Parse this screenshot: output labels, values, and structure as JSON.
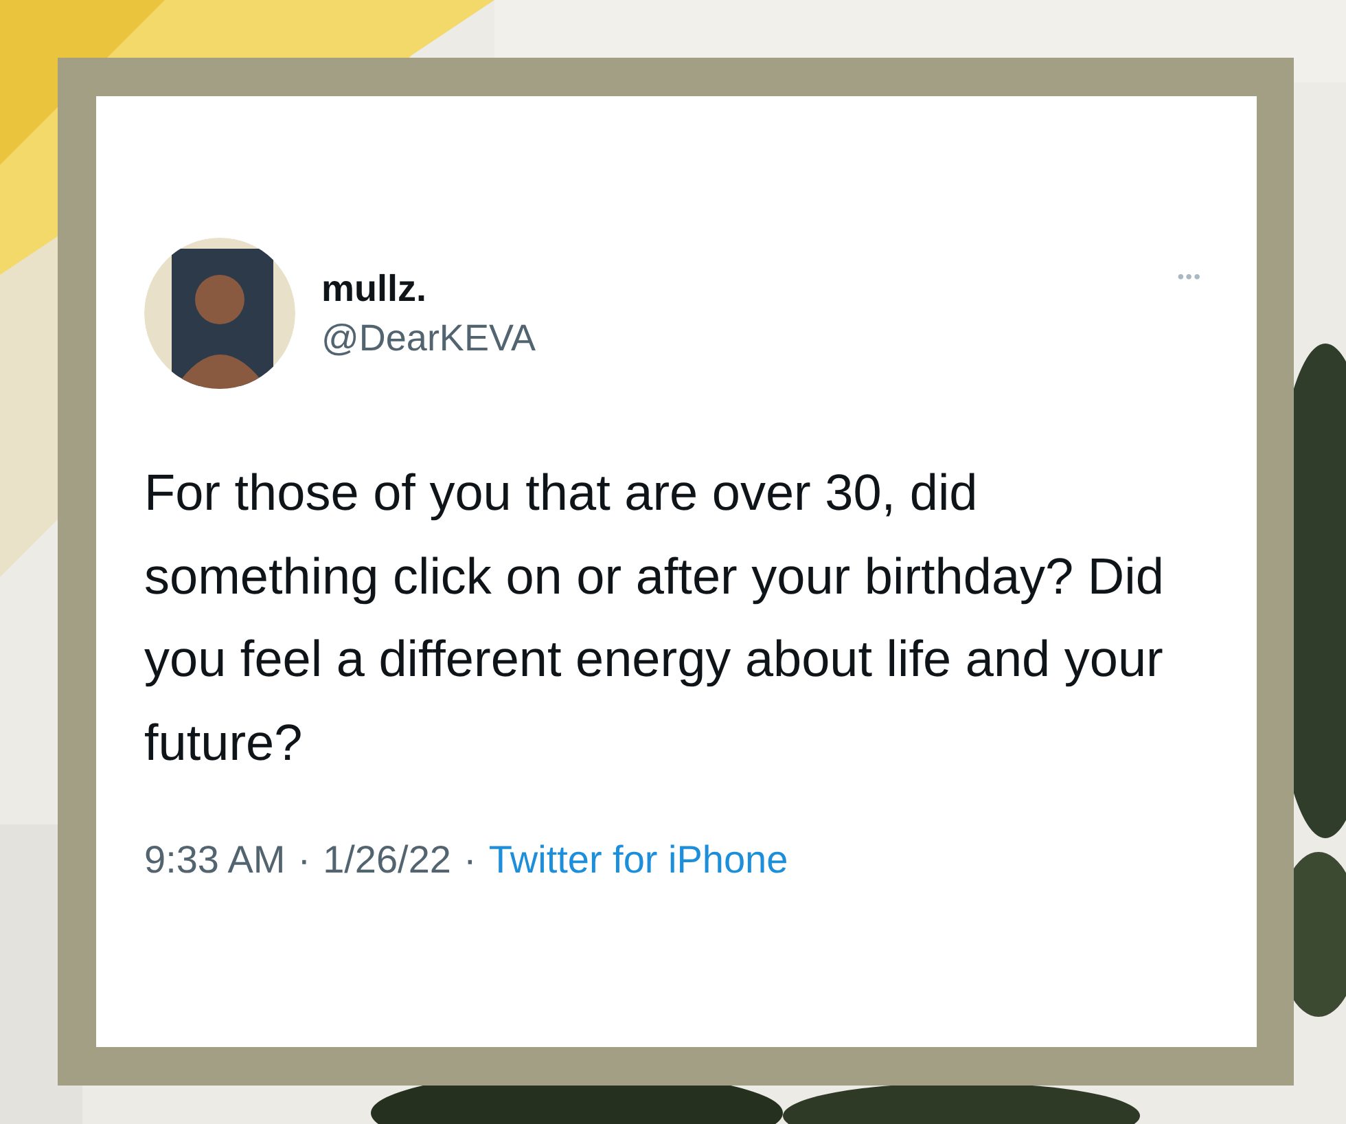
{
  "tweet": {
    "name": "mullz.",
    "handle": "@DearKEVA",
    "more_icon": "•••",
    "text": "For those of you that are over 30, did something click on or after your birthday? Did you feel a different energy about life and your future?",
    "footer": [
      {
        "kind": "text",
        "text": "9:33 AM"
      },
      {
        "kind": "text",
        "text": "·"
      },
      {
        "kind": "text",
        "text": "1/26/22"
      },
      {
        "kind": "text",
        "text": "·"
      },
      {
        "kind": "link",
        "text": "Twitter for iPhone"
      }
    ]
  }
}
